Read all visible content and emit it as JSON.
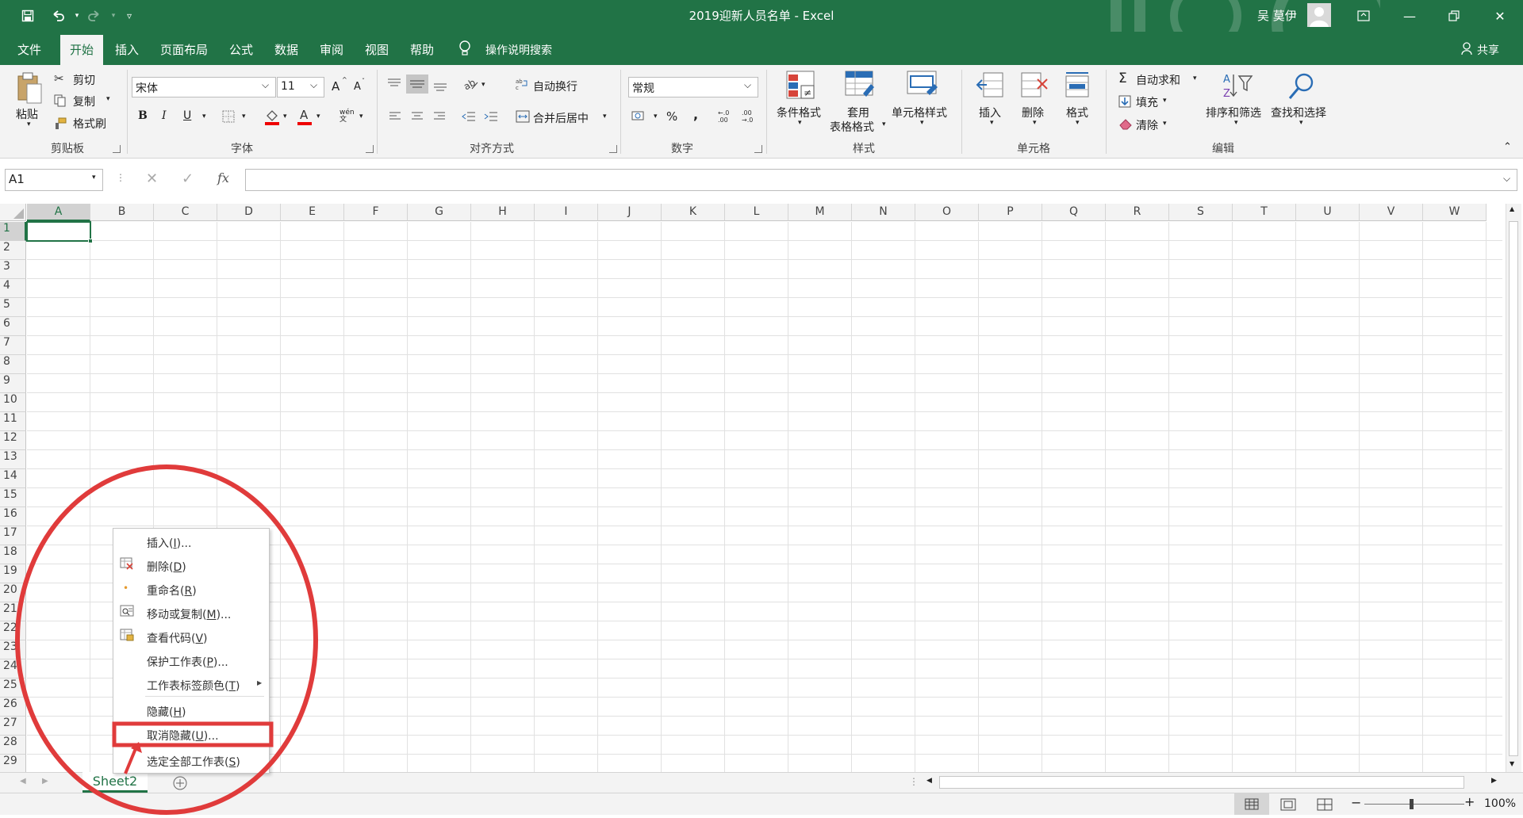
{
  "window": {
    "title": "2019迎新人员名单  -  Excel",
    "user": "吴 莫伊"
  },
  "tabs": [
    "文件",
    "开始",
    "插入",
    "页面布局",
    "公式",
    "数据",
    "审阅",
    "视图",
    "帮助"
  ],
  "tell_me": "操作说明搜索",
  "share": "共享",
  "ribbon": {
    "clipboard": {
      "paste": "粘贴",
      "cut": "剪切",
      "copy": "复制",
      "format_painter": "格式刷",
      "label": "剪贴板"
    },
    "font": {
      "name": "宋体",
      "size": "11",
      "label": "字体",
      "bold": "B",
      "italic": "I",
      "underline": "U",
      "grow": "A",
      "shrink": "A",
      "phonetic": "wén"
    },
    "alignment": {
      "wrap": "自动换行",
      "merge": "合并后居中",
      "label": "对齐方式"
    },
    "number": {
      "format": "常规",
      "percent": "%",
      "comma": ",",
      "inc_dec": "←.0\n.00",
      "dec_dec": ".00\n→.0",
      "label": "数字"
    },
    "styles": {
      "conditional": "条件格式",
      "table_line1": "套用",
      "table_line2": "表格格式",
      "cell_styles": "单元格样式",
      "label": "样式"
    },
    "cells": {
      "insert": "插入",
      "delete": "删除",
      "format": "格式",
      "label": "单元格"
    },
    "editing": {
      "autosum": "自动求和",
      "fill": "填充",
      "clear": "清除",
      "sort": "排序和筛选",
      "find": "查找和选择",
      "label": "编辑"
    }
  },
  "formula_bar": {
    "name_box": "A1",
    "fx": "fx",
    "value": ""
  },
  "columns": [
    "A",
    "B",
    "C",
    "D",
    "E",
    "F",
    "G",
    "H",
    "I",
    "J",
    "K",
    "L",
    "M",
    "N",
    "O",
    "P",
    "Q",
    "R",
    "S",
    "T",
    "U",
    "V",
    "W"
  ],
  "rows": [
    "1",
    "2",
    "3",
    "4",
    "5",
    "6",
    "7",
    "8",
    "9",
    "10",
    "11",
    "12",
    "13",
    "14",
    "15",
    "16",
    "17",
    "18",
    "19",
    "20",
    "21",
    "22",
    "23",
    "24",
    "25",
    "26",
    "27",
    "28",
    "29"
  ],
  "sheet_tab": "Sheet2",
  "context_menu": [
    {
      "label": "插入(",
      "key": "I",
      "suffix": ")..."
    },
    {
      "label": "删除(",
      "key": "D",
      "suffix": ")"
    },
    {
      "label": "重命名(",
      "key": "R",
      "suffix": ")"
    },
    {
      "label": "移动或复制(",
      "key": "M",
      "suffix": ")..."
    },
    {
      "label": "查看代码(",
      "key": "V",
      "suffix": ")"
    },
    {
      "label": "保护工作表(",
      "key": "P",
      "suffix": ")..."
    },
    {
      "label": "工作表标签颜色(",
      "key": "T",
      "suffix": ")"
    },
    {
      "label": "隐藏(",
      "key": "H",
      "suffix": ")"
    },
    {
      "label": "取消隐藏(",
      "key": "U",
      "suffix": ")..."
    },
    {
      "label": "选定全部工作表(",
      "key": "S",
      "suffix": ")"
    }
  ],
  "status": {
    "zoom": "100%"
  },
  "colors": {
    "excel_green": "#217346",
    "annotation_red": "#e03b3b",
    "grid": "#e1e1e1"
  }
}
